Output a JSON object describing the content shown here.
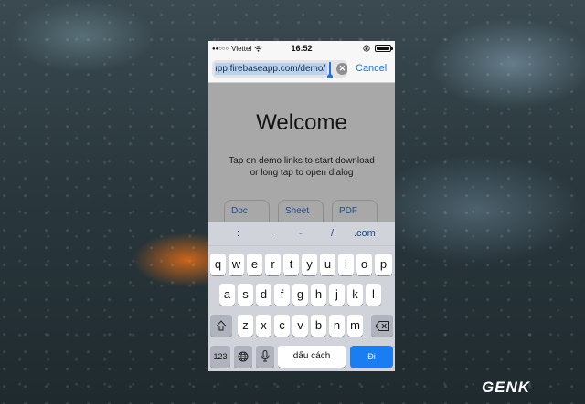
{
  "status": {
    "carrier": "Viettel",
    "time": "16:52"
  },
  "urlbar": {
    "url": "ıpp.firebaseapp.com/demo/",
    "cancel": "Cancel"
  },
  "page": {
    "title": "Welcome",
    "subtitle_line1": "Tap on demo links to start download",
    "subtitle_line2": "or long tap to open dialog",
    "buttons": [
      "Doc",
      "Sheet",
      "PDF"
    ]
  },
  "keyboard": {
    "suggestions": [
      ":",
      ".",
      "-",
      "/",
      ".com"
    ],
    "row1": [
      "q",
      "w",
      "e",
      "r",
      "t",
      "y",
      "u",
      "i",
      "o",
      "p"
    ],
    "row2": [
      "a",
      "s",
      "d",
      "f",
      "g",
      "h",
      "j",
      "k",
      "l"
    ],
    "row3": [
      "z",
      "x",
      "c",
      "v",
      "b",
      "n",
      "m"
    ],
    "numbers_key": "123",
    "space_key": "dấu cách",
    "go_key": "Đi",
    "icons": {
      "shift": "shift-icon",
      "delete": "backspace-icon",
      "globe": "globe-icon",
      "mic": "microphone-icon"
    }
  },
  "watermark": "GENK",
  "colors": {
    "accent": "#1a7ef2",
    "link": "#1d4d8f"
  }
}
